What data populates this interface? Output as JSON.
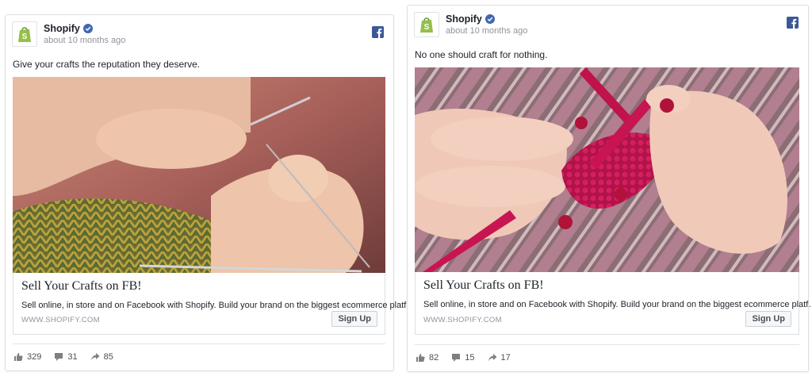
{
  "colors": {
    "facebook_blue": "#3b5998",
    "shopify_green": "#95bf47",
    "verified_blue": "#4267b2"
  },
  "posts": [
    {
      "page_name": "Shopify",
      "timestamp": "about 10 months ago",
      "caption": "Give your crafts the reputation they deserve.",
      "image_description_icon": "knitting-photo",
      "headline": "Sell Your Crafts on FB!",
      "description": "Sell online, in store and on Facebook with Shopify. Build your brand on the biggest ecommerce platf…",
      "domain": "WWW.SHOPIFY.COM",
      "cta": "Sign Up",
      "likes": "329",
      "comments": "31",
      "shares": "85"
    },
    {
      "page_name": "Shopify",
      "timestamp": "about 10 months ago",
      "caption": "No one should craft for nothing.",
      "image_description_icon": "knitting-photo",
      "headline": "Sell Your Crafts on FB!",
      "description": "Sell online, in store and on Facebook with Shopify. Build your brand on the biggest ecommerce platf…",
      "domain": "WWW.SHOPIFY.COM",
      "cta": "Sign Up",
      "likes": "82",
      "comments": "15",
      "shares": "17"
    }
  ]
}
